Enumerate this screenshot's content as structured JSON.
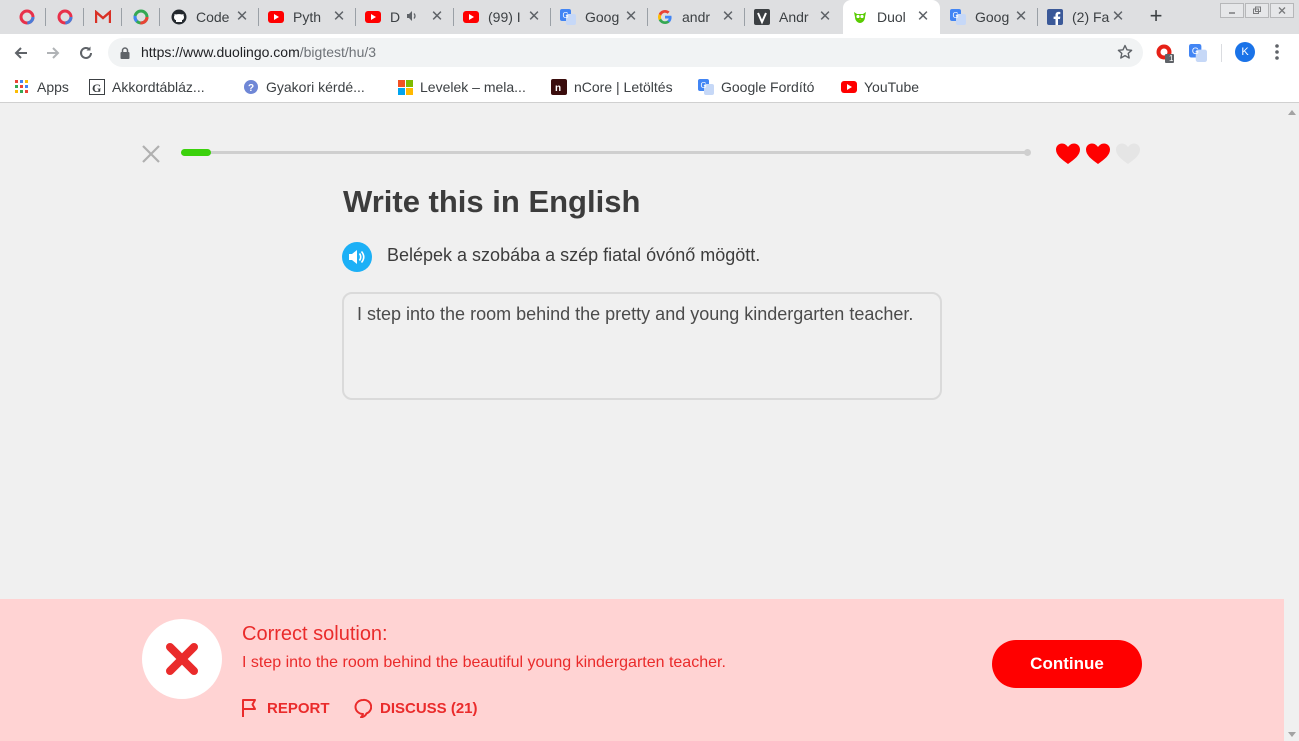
{
  "browser": {
    "tabs": [
      {
        "title": "Code",
        "icon": "github-icon"
      },
      {
        "title": "Pyth",
        "icon": "youtube-icon"
      },
      {
        "title": "D",
        "icon": "youtube-icon"
      },
      {
        "title": "(99) I",
        "icon": "youtube-icon"
      },
      {
        "title": "Goog",
        "icon": "google-translate-icon"
      },
      {
        "title": "andr",
        "icon": "google-icon"
      },
      {
        "title": "Andr",
        "icon": "v-icon"
      },
      {
        "title": "Duol",
        "icon": "duolingo-icon"
      },
      {
        "title": "Goog",
        "icon": "google-translate-icon"
      },
      {
        "title": "(2) Fa",
        "icon": "facebook-icon"
      }
    ],
    "new_tab_label": "+",
    "url_host": "https://www.duolingo.com",
    "url_path": "/bigtest/hu/3",
    "extension_badge": "1",
    "avatar_letter": "K",
    "bookmarks": [
      {
        "label": "Apps",
        "icon": "apps-icon"
      },
      {
        "label": "Akkordtábláz...",
        "icon": "page-icon"
      },
      {
        "label": "Gyakori kérdé...",
        "icon": "help-icon"
      },
      {
        "label": "Levelek – mela...",
        "icon": "microsoft-icon"
      },
      {
        "label": "nCore | Letöltés",
        "icon": "ncore-icon"
      },
      {
        "label": "Google Fordító",
        "icon": "google-translate-icon"
      },
      {
        "label": "YouTube",
        "icon": "youtube-icon"
      }
    ]
  },
  "lesson": {
    "progress": 0.035,
    "hearts_total": 3,
    "hearts_remaining": 2,
    "heading": "Write this in English",
    "prompt": "Belépek a szobába a szép fiatal óvónő mögött.",
    "answer": "I step into the room behind the pretty and young kindergarten teacher."
  },
  "feedback": {
    "title": "Correct solution:",
    "solution": "I step into the room behind the beautiful young kindergarten teacher.",
    "report_label": "REPORT",
    "discuss_label": "DISCUSS (21)",
    "continue_label": "Continue"
  },
  "colors": {
    "accent_blue": "#1cb0f6",
    "progress_green": "#3bd10c",
    "error_red": "#ea2b2b",
    "heart_red": "#ff0000",
    "feedback_bg": "#ffd3d3"
  }
}
